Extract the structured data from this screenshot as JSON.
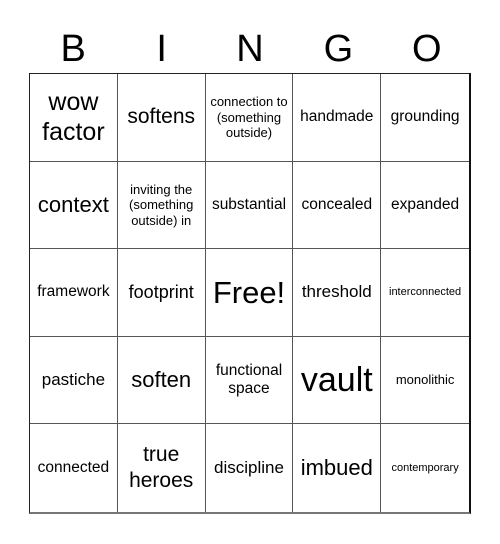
{
  "header": {
    "letters": [
      "B",
      "I",
      "N",
      "G",
      "O"
    ]
  },
  "board": {
    "rows": [
      [
        "wow factor",
        "softens",
        "connection to (something outside)",
        "handmade",
        "grounding"
      ],
      [
        "context",
        "inviting the (something outside) in",
        "substantial",
        "concealed",
        "expanded"
      ],
      [
        "framework",
        "footprint",
        "Free!",
        "threshold",
        "interconnected"
      ],
      [
        "pastiche",
        "soften",
        "functional space",
        "vault",
        "monolithic"
      ],
      [
        "connected",
        "true heroes",
        "discipline",
        "imbued",
        "contemporary"
      ]
    ],
    "free_space_label": "Free!"
  }
}
